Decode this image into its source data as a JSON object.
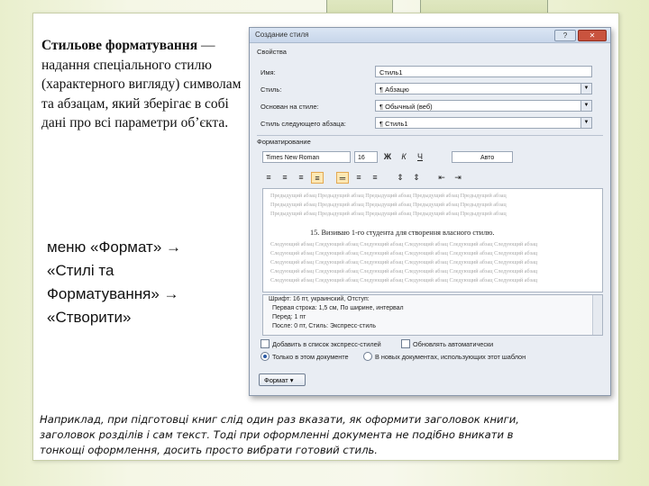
{
  "definition": {
    "term": "Стильове форматування",
    "text": "— надання спеціального стилю (характерного вигляду) символам та абзацам, який зберігає в собі дані про всі параметри об’єкта."
  },
  "menu_path": {
    "line1": "меню «Формат» →",
    "line2": "«Стилі та",
    "line3": "Форматування» →",
    "line4": "«Створити»"
  },
  "example": {
    "line1": "Наприклад, при підготовці книг слід один раз вказати, як оформити заголовок книги,",
    "line2": "заголовок розділів і сам текст. Тоді при оформленні документа не подібно вникати в",
    "line3": "тонкощі оформлення, досить просто вибрати готовий стиль."
  },
  "dialog": {
    "title": "Создание стиля",
    "help_button": "?",
    "close_button": "✕",
    "properties_group": "Свойства",
    "fields": [
      {
        "label": "Имя:",
        "value": "Стиль1"
      },
      {
        "label": "Стиль:",
        "value": "¶ Абзацю"
      },
      {
        "label": "Основан на стиле:",
        "value": "¶ Обычный (веб)"
      },
      {
        "label": "Стиль следующего абзаца:",
        "value": "¶ Стиль1"
      }
    ],
    "formatting_group": "Форматирование",
    "toolbar": {
      "font": "Times New Roman",
      "size": "16",
      "bold": "Ж",
      "italic": "К",
      "underline": "Ч",
      "color": "Авто"
    },
    "preview": {
      "before_text": "Предыдущий абзац Предыдущий абзац Предыдущий абзац Предыдущий абзац Предыдущий абзац",
      "main_text": "15. Визиваю 1-го студента для створення власного стилю.",
      "after_text": "Следующий абзац Следующий абзац Следующий абзац Следующий абзац Следующий абзац Следующий абзац"
    },
    "description": [
      "Шрифт: 16 пт, украинский, Отступ:",
      "Первая строка: 1,5 см, По ширине, интервал",
      "Перед: 1 пт",
      "После: 0 пт, Стиль: Экспресс-стиль"
    ],
    "options": {
      "add_to_quick": "Добавить в список экспресс-стилей",
      "auto_update": "Обновлять автоматически",
      "only_this_doc": "Только в этом документе",
      "new_docs": "В новых документах, использующих этот шаблон"
    },
    "format_button": "Формат ▾"
  }
}
